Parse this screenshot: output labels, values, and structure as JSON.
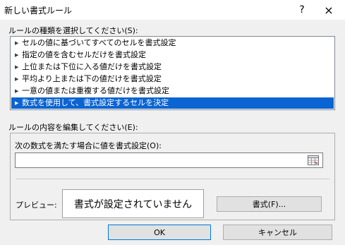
{
  "window": {
    "title": "新しい書式ルール",
    "help_icon": "?",
    "close_icon": "×"
  },
  "rule_type": {
    "label": "ルールの種類を選択してください(S):",
    "items": [
      {
        "label": "セルの値に基づいてすべてのセルを書式設定"
      },
      {
        "label": "指定の値を含むセルだけを書式設定"
      },
      {
        "label": "上位または下位に入る値だけを書式設定"
      },
      {
        "label": "平均より上または下の値だけを書式設定"
      },
      {
        "label": "一意の値または重複する値だけを書式設定"
      },
      {
        "label": "数式を使用して、書式設定するセルを決定"
      }
    ],
    "selected_index": 5
  },
  "rule_description": {
    "label": "ルールの内容を編集してください(E):",
    "formula_label": "次の数式を満たす場合に値を書式設定(O):",
    "formula_value": "",
    "preview_label": "プレビュー:",
    "preview_text": "書式が設定されていません",
    "format_button": "書式(F)..."
  },
  "buttons": {
    "ok": "OK",
    "cancel": "キャンセル"
  },
  "colors": {
    "selected_bg": "#0a64d2",
    "dialog_bg": "#f0f0f0",
    "default_button_border": "#0078d7"
  }
}
